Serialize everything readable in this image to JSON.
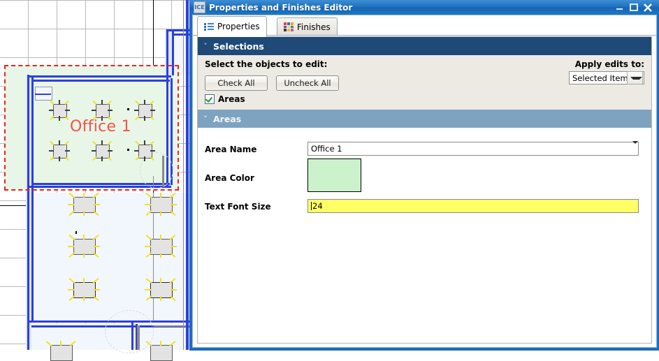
{
  "canvas": {
    "area_label": "Office 1",
    "area_fill_color": "#e8f6e8",
    "selection_color": "#f41f1f",
    "wall_color": "#2b3fe0",
    "room_fill_color": "#f2f7fd",
    "grid_color": "#b9b9b9"
  },
  "dialog": {
    "icon": "ice-app-icon",
    "title": "Properties and Finishes Editor",
    "window_buttons": {
      "minimize": "minimize-icon",
      "maximize": "maximize-icon",
      "close": "close-icon"
    },
    "tabs": [
      {
        "label": "Properties",
        "icon": "list-icon",
        "active": true
      },
      {
        "label": "Finishes",
        "icon": "color-swatch-icon",
        "active": false
      }
    ],
    "finishes_icon_colors": [
      "#e8412c",
      "#2f6fb0",
      "#f0a21e",
      "#7b3fa0",
      "#d9d4c8",
      "#3d8f3d",
      "#3b3b3b",
      "#e8c23a",
      "#c85a9e"
    ],
    "selections": {
      "header": "Selections",
      "chevron": "chevron-down-icon",
      "instruction": "Select the objects to edit:",
      "check_all_label": "Check All",
      "uncheck_all_label": "Uncheck All",
      "areas_checkbox_label": "Areas",
      "areas_checked": true,
      "apply_label": "Apply edits to:",
      "apply_value": "Selected Items",
      "header_color": "#1f4a78"
    },
    "areas": {
      "header": "Areas",
      "chevron": "chevron-down-icon",
      "header_color": "#7ea3c0",
      "fields": [
        {
          "label": "Area Name",
          "value": "Office 1",
          "type": "combo"
        },
        {
          "label": "Area Color",
          "value": "",
          "type": "color",
          "color": "#ccf2cc"
        },
        {
          "label": "Text Font Size",
          "value": "24",
          "type": "text",
          "background": "#ffff66"
        }
      ]
    }
  }
}
